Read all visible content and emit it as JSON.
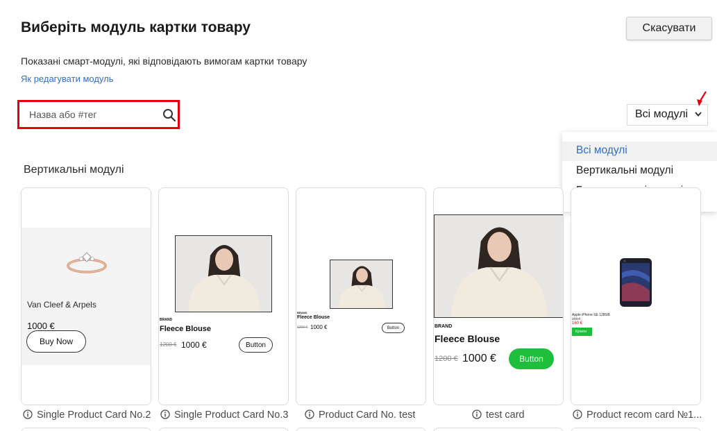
{
  "header": {
    "title": "Виберіть модуль картки товару",
    "cancel_label": "Скасувати",
    "subtitle": "Показані смарт-модулі, які відповідають вимогам картки товару",
    "help_link": "Як редагувати модуль"
  },
  "search": {
    "placeholder": "Назва або #тег",
    "value": ""
  },
  "filter": {
    "selected": "Всі модулі",
    "options": [
      "Всі модулі",
      "Вертикальні модулі",
      "Горизонтальні модулі"
    ]
  },
  "section": {
    "title": "Вертикальні модулі"
  },
  "cards": [
    {
      "caption": "Single Product Card No.2",
      "brand": "Van Cleef & Arpels",
      "price": "1000 €",
      "button": "Buy Now"
    },
    {
      "caption": "Single Product Card No.3",
      "brand": "BRAND",
      "name": "Fleece Blouse",
      "old_price": "1200 €",
      "price": "1000 €",
      "button": "Button"
    },
    {
      "caption": "Product Card No. test",
      "brand": "BRAND",
      "name": "Fleece Blouse",
      "old_price": "1200 €",
      "price": "1000 €",
      "button": "Button"
    },
    {
      "caption": "test card",
      "brand": "BRAND",
      "name": "Fleece Blouse",
      "old_price": "1200 €",
      "price": "1000 €",
      "button": "Button"
    },
    {
      "caption": "Product recom card №1...",
      "name": "Apple iPhone SE 128GB",
      "old_price": "200 €",
      "price": "160 €",
      "button": "Купити"
    }
  ],
  "colors": {
    "accent": "#2f6ec5",
    "highlight_border": "#e3000f",
    "green_button": "#1fbf3d",
    "sale_price": "#e3000f"
  }
}
